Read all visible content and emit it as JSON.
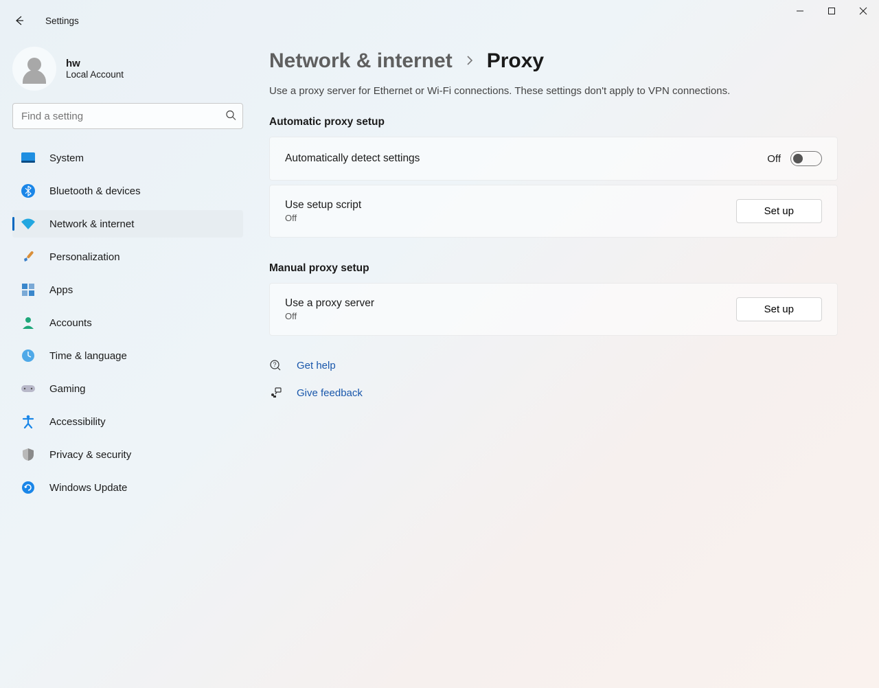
{
  "app_title": "Settings",
  "user": {
    "name": "hw",
    "subtitle": "Local Account"
  },
  "search": {
    "placeholder": "Find a setting"
  },
  "sidebar": {
    "items": [
      {
        "label": "System"
      },
      {
        "label": "Bluetooth & devices"
      },
      {
        "label": "Network & internet"
      },
      {
        "label": "Personalization"
      },
      {
        "label": "Apps"
      },
      {
        "label": "Accounts"
      },
      {
        "label": "Time & language"
      },
      {
        "label": "Gaming"
      },
      {
        "label": "Accessibility"
      },
      {
        "label": "Privacy & security"
      },
      {
        "label": "Windows Update"
      }
    ],
    "active_index": 2
  },
  "breadcrumb": {
    "parent": "Network & internet",
    "current": "Proxy"
  },
  "description": "Use a proxy server for Ethernet or Wi-Fi connections. These settings don't apply to VPN connections.",
  "sections": {
    "automatic": {
      "title": "Automatic proxy setup",
      "detect": {
        "label": "Automatically detect settings",
        "state_label": "Off",
        "on": false
      },
      "script": {
        "label": "Use setup script",
        "sub": "Off",
        "button": "Set up"
      }
    },
    "manual": {
      "title": "Manual proxy setup",
      "server": {
        "label": "Use a proxy server",
        "sub": "Off",
        "button": "Set up"
      }
    }
  },
  "links": {
    "help": "Get help",
    "feedback": "Give feedback"
  }
}
